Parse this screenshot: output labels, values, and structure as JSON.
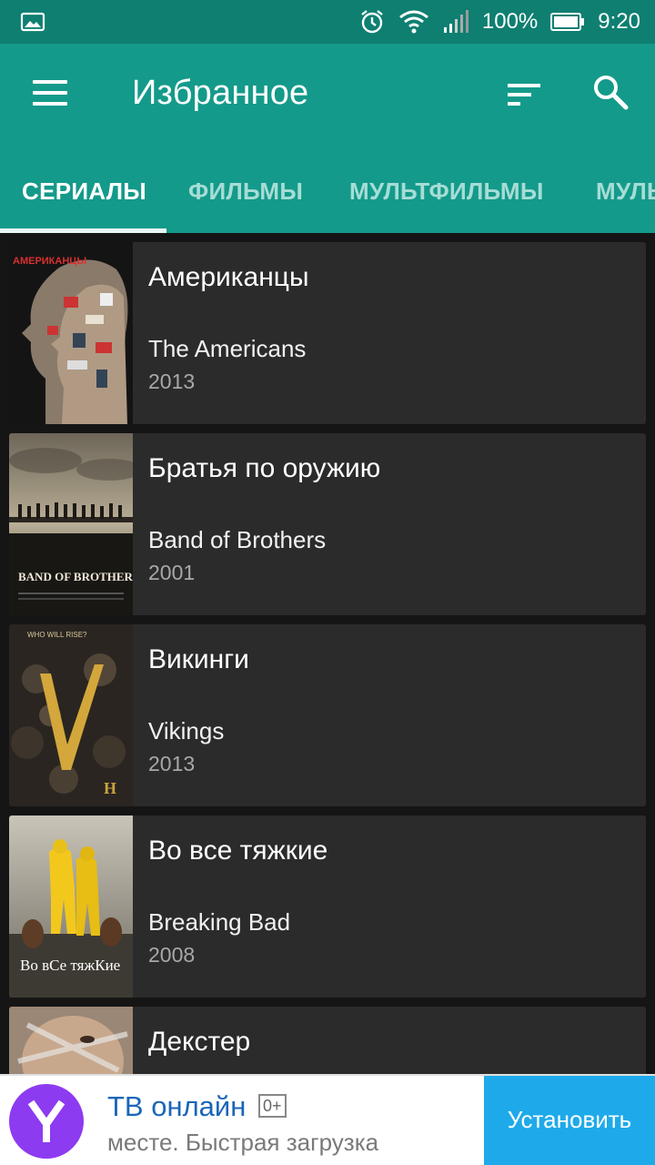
{
  "status_bar": {
    "battery": "100%",
    "time": "9:20",
    "icons": [
      "image-icon",
      "alarm-icon",
      "wifi-icon",
      "signal-icon",
      "battery-icon"
    ]
  },
  "app_bar": {
    "title": "Избранное",
    "icons": [
      "menu-icon",
      "sort-icon",
      "search-icon"
    ]
  },
  "tabs": [
    {
      "label": "СЕРИАЛЫ",
      "active": true
    },
    {
      "label": "ФИЛЬМЫ",
      "active": false
    },
    {
      "label": "МУЛЬТФИЛЬМЫ",
      "active": false
    },
    {
      "label": "МУЛЬ",
      "active": false
    }
  ],
  "items": [
    {
      "title": "Американцы",
      "original_title": "The Americans",
      "year": "2013",
      "poster_text": "АМЕРИКАНЦЫ"
    },
    {
      "title": "Братья по оружию",
      "original_title": "Band of Brothers",
      "year": "2001",
      "poster_text": "BAND OF BROTHERS"
    },
    {
      "title": "Викинги",
      "original_title": "Vikings",
      "year": "2013",
      "poster_text": "WHO WILL RISE?"
    },
    {
      "title": "Во все тяжкие",
      "original_title": "Breaking Bad",
      "year": "2008",
      "poster_text": "Во вСе тяжКие"
    },
    {
      "title": "Декстер",
      "original_title": "",
      "year": "",
      "poster_text": ""
    }
  ],
  "ad": {
    "title": "ТВ онлайн",
    "age_rating": "0+",
    "description": "месте. Быстрая загрузка",
    "install_label": "Установить"
  },
  "colors": {
    "status_bar": "#0e7f71",
    "app_bar": "#149a8a",
    "tab_inactive": "#a6ddd6",
    "card": "#2b2b2b",
    "background": "#151515",
    "ad_button": "#1eaaea",
    "ad_logo": "#8d3bf0"
  }
}
